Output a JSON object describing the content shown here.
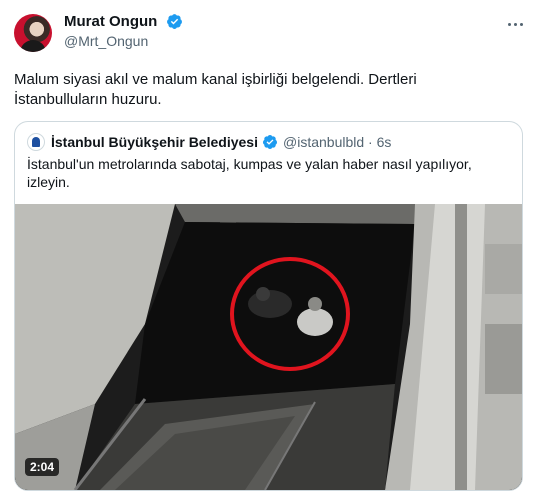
{
  "author": {
    "name": "Murat Ongun",
    "handle": "@Mrt_Ongun",
    "verified_icon": "verified-badge-icon",
    "avatar_icon": "avatar-photo"
  },
  "tweet": {
    "text_line1": "Malum siyasi akıl ve malum kanal işbirliği belgelendi. Dertleri",
    "text_line2": "İstanbulluların huzuru."
  },
  "quoted": {
    "name": "İstanbul Büyükşehir Belediyesi",
    "handle_time": "@istanbulbld · 6s",
    "text_line1": "İstanbul'un metrolarında sabotaj, kumpas ve yalan haber nasıl yapılıyor,",
    "text_line2": "izleyin.",
    "video_duration": "2:04"
  },
  "colors": {
    "verified": "#1d9bf0",
    "highlight_circle": "#e0141e",
    "secondary_text": "#536471",
    "border": "#cfd9de"
  }
}
